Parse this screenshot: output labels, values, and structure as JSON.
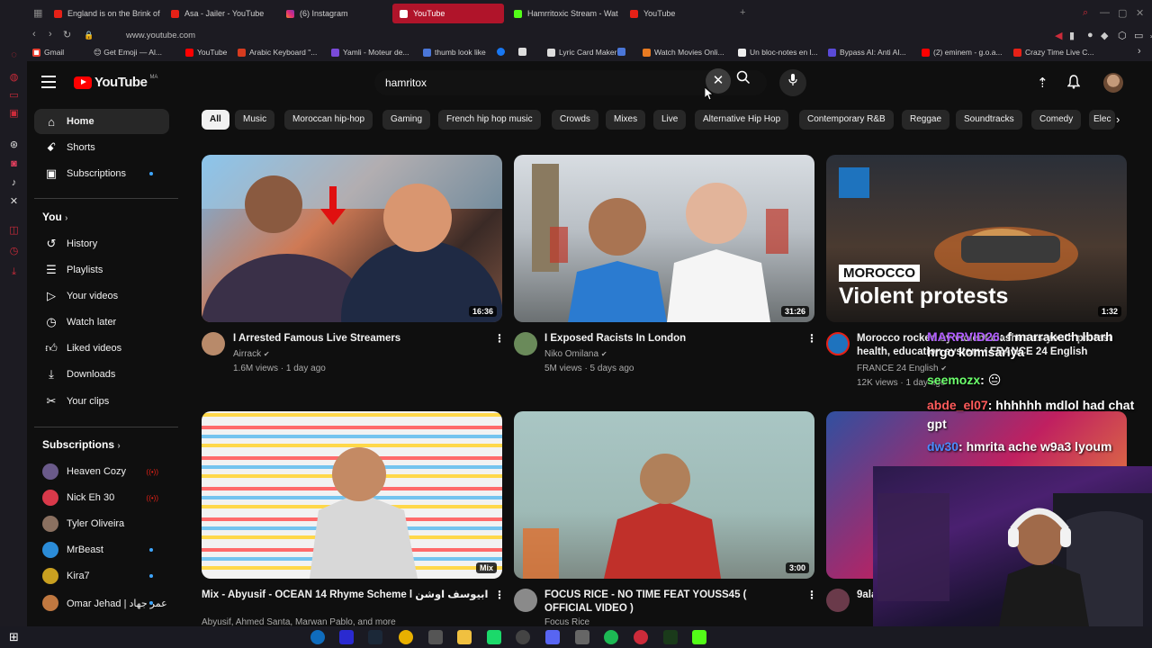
{
  "browser": {
    "tabs": [
      {
        "title": "England is on the Brink of",
        "icon": "youtube-favicon"
      },
      {
        "title": "Asa - Jailer - YouTube",
        "icon": "youtube-favicon"
      },
      {
        "title": "(6) Instagram",
        "icon": "instagram-favicon"
      },
      {
        "title": "YouTube",
        "icon": "youtube-favicon",
        "active": true
      },
      {
        "title": "Hamrritoxic Stream - Wat",
        "icon": "kick-favicon"
      },
      {
        "title": "YouTube",
        "icon": "youtube-favicon"
      }
    ],
    "url": "www.youtube.com",
    "bookmarks": [
      "Gmail",
      "😊 Get Emoji — Al...",
      "YouTube",
      "Arabic Keyboard \"...",
      "Yamli - Moteur de...",
      "thumb look like",
      "",
      "",
      "Lyric Card Maker",
      "",
      "Watch Movies Onli...",
      "Un bloc-notes en l...",
      "Bypass AI: Anti AI...",
      "(2) eminem - g.o.a...",
      "Crazy Time Live C..."
    ]
  },
  "header": {
    "logo_text": "YouTube",
    "country_code": "MA",
    "search_value": "hamritox"
  },
  "sidebar": {
    "main": [
      {
        "label": "Home",
        "icon": "home-icon",
        "active": true
      },
      {
        "label": "Shorts",
        "icon": "shorts-icon"
      },
      {
        "label": "Subscriptions",
        "icon": "subscriptions-icon",
        "dot": true
      }
    ],
    "you_title": "You",
    "you": [
      {
        "label": "History",
        "icon": "history-icon"
      },
      {
        "label": "Playlists",
        "icon": "playlists-icon"
      },
      {
        "label": "Your videos",
        "icon": "your-videos-icon"
      },
      {
        "label": "Watch later",
        "icon": "watch-later-icon"
      },
      {
        "label": "Liked videos",
        "icon": "liked-videos-icon"
      },
      {
        "label": "Downloads",
        "icon": "downloads-icon"
      },
      {
        "label": "Your clips",
        "icon": "clips-icon"
      }
    ],
    "subs_title": "Subscriptions",
    "subs": [
      {
        "label": "Heaven Cozy",
        "live": true,
        "color": "#6a5a8a"
      },
      {
        "label": "Nick Eh 30",
        "live": true,
        "color": "#d9394a"
      },
      {
        "label": "Tyler Oliveira",
        "color": "#8a7060"
      },
      {
        "label": "MrBeast",
        "dot": true,
        "color": "#2b8cd8"
      },
      {
        "label": "Kira7",
        "dot": true,
        "color": "#c9a020"
      },
      {
        "label": "Omar Jehad | عمر جهاد",
        "dot": true,
        "color": "#c07840"
      }
    ]
  },
  "chips": [
    "All",
    "Music",
    "Moroccan hip-hop",
    "Gaming",
    "French hip hop music",
    "Crowds",
    "Mixes",
    "Live",
    "Alternative Hip Hop",
    "Contemporary R&B",
    "Reggae",
    "Soundtracks",
    "Comedy",
    "Elec"
  ],
  "videos": [
    {
      "title": "I Arrested Famous Live Streamers",
      "channel": "Airrack",
      "meta": "1.6M views · 1 day ago",
      "duration": "16:36"
    },
    {
      "title": "I Exposed Racists In London",
      "channel": "Niko Omilana",
      "meta": "5M views · 5 days ago",
      "duration": "31:26"
    },
    {
      "title": "Morocco rocked by violent clashes as youth protest health, education system • FRANCE 24 English",
      "channel": "FRANCE 24 English",
      "meta": "12K views · 1 day ago",
      "duration": "1:32",
      "overlay_tag": "MOROCCO",
      "overlay_title": "Violent protests"
    },
    {
      "title": "Mix - Abyusif - OCEAN 14 Rhyme Scheme l ابيوسف اوشن 14 رايم سكيم",
      "channel": "Abyusif, Ahmed Santa, Marwan Pablo, and more",
      "meta": "",
      "duration": "Mix"
    },
    {
      "title": "FOCUS RICE - NO TIME FEAT YOUSS45 ( OFFICIAL VIDEO )",
      "channel": "Focus Rice",
      "meta": "",
      "duration": "3:00"
    },
    {
      "title": "9ala",
      "channel": "",
      "meta": "",
      "duration": ""
    }
  ],
  "stream_chat": [
    {
      "user": "MARRVID26",
      "text": ": f marrakech lbarh hrgo komisariya"
    },
    {
      "user": "seemozx",
      "text": ": 😐"
    },
    {
      "user": "abde_el07",
      "text": ": hhhhhh mdlol had chat gpt"
    },
    {
      "user": "dw30",
      "text": ": hmrita ache w9a3 lyoum"
    }
  ]
}
